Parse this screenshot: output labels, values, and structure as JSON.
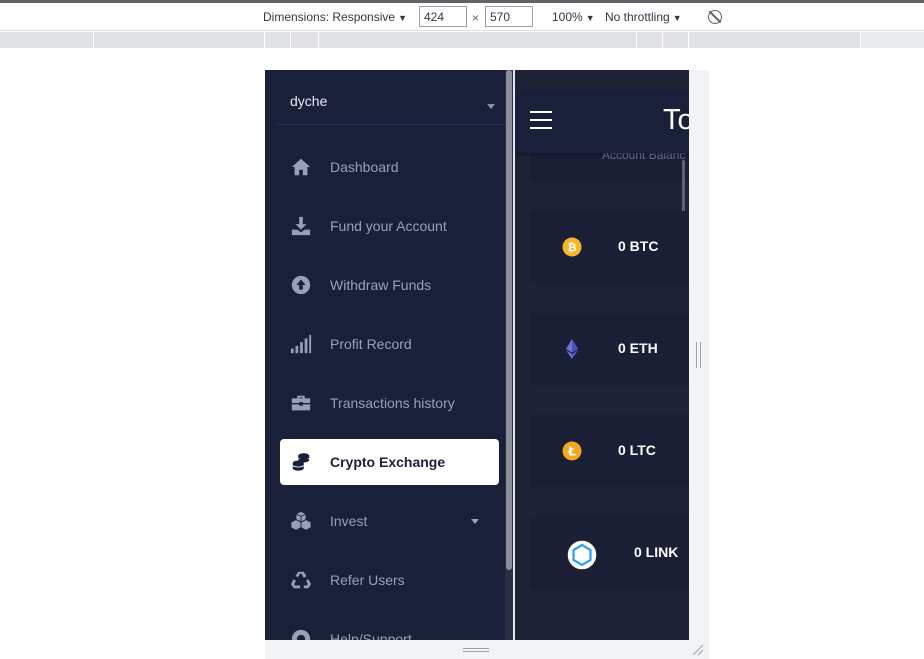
{
  "devtools": {
    "dimensions_label": "Dimensions: Responsive",
    "width_value": "424",
    "height_value": "570",
    "times": "×",
    "zoom": "100%",
    "throttling": "No throttling",
    "icons": [
      "caret-down-icon",
      "rotate-icon",
      "resize-handle-icon"
    ]
  },
  "sidebar": {
    "user_name": "dyche",
    "items": [
      {
        "label": "Dashboard",
        "icon": "home-icon"
      },
      {
        "label": "Fund your Account",
        "icon": "download-icon"
      },
      {
        "label": "Withdraw Funds",
        "icon": "upload-circle-icon"
      },
      {
        "label": "Profit Record",
        "icon": "signal-bars-icon"
      },
      {
        "label": "Transactions history",
        "icon": "briefcase-icon"
      },
      {
        "label": "Crypto Exchange",
        "icon": "coins-icon",
        "active": true
      },
      {
        "label": "Invest",
        "icon": "cubes-icon",
        "has_submenu": true
      },
      {
        "label": "Refer Users",
        "icon": "recycle-icon"
      },
      {
        "label": "Help/Support",
        "icon": "support-icon"
      }
    ]
  },
  "header": {
    "title": "To",
    "balance_label": "Account Balanc"
  },
  "coins": [
    {
      "label": "0 BTC",
      "icon": "bitcoin-icon",
      "color": "#f7b62b"
    },
    {
      "label": "0 ETH",
      "icon": "ethereum-icon",
      "color": "#6c72d9"
    },
    {
      "label": "0 LTC",
      "icon": "litecoin-icon",
      "color": "#f5a623"
    },
    {
      "label": "0 LINK",
      "icon": "chainlink-icon",
      "color": "#2a5ada"
    }
  ],
  "colors": {
    "sidebar_bg": "#1b203a",
    "main_bg": "#1e2338",
    "card_bg": "#1a1f36",
    "muted_text": "#9aa0b4",
    "active_bg": "#ffffff"
  }
}
